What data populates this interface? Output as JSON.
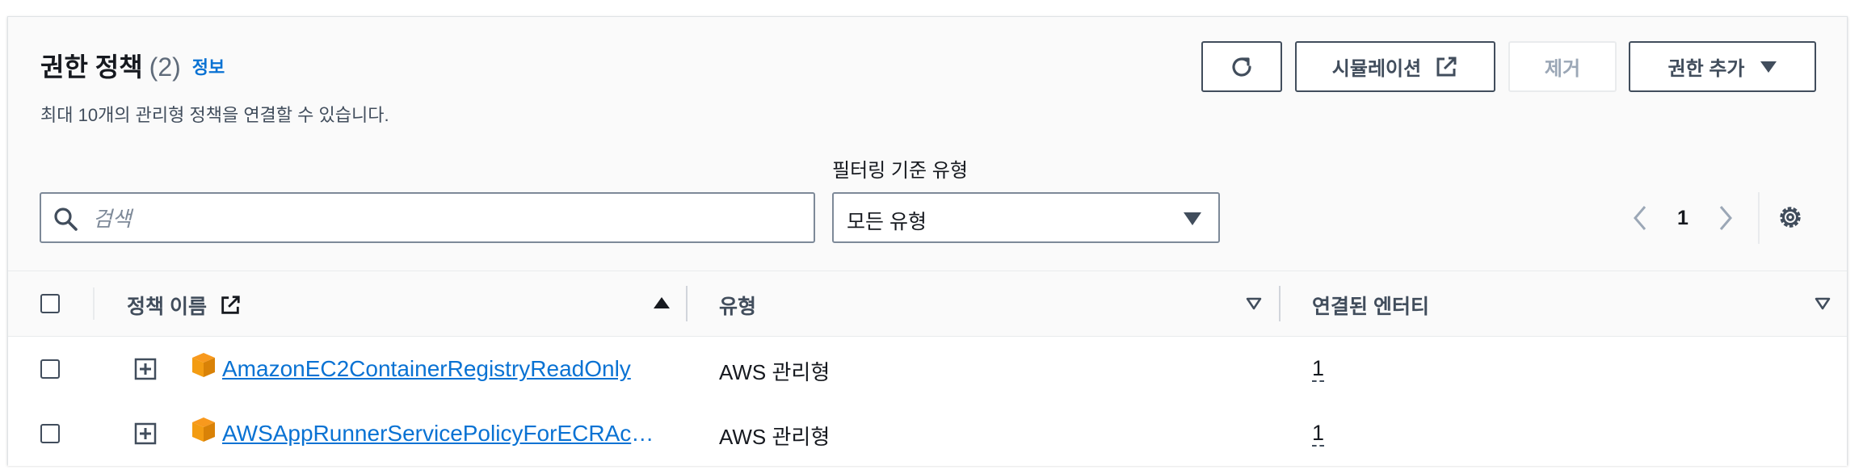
{
  "header": {
    "title": "권한 정책",
    "count": "(2)",
    "info_link": "정보",
    "subtitle": "최대 10개의 관리형 정책을 연결할 수 있습니다."
  },
  "actions": {
    "refresh_icon": "refresh-icon",
    "simulate_label": "시뮬레이션",
    "remove_label": "제거",
    "add_permission_label": "권한 추가"
  },
  "filters": {
    "search_placeholder": "검색",
    "search_value": "",
    "filter_label": "필터링 기준 유형",
    "filter_value": "모든 유형"
  },
  "pagination": {
    "current_page": "1"
  },
  "table": {
    "columns": [
      {
        "label": "정책 이름",
        "sort": "ascending"
      },
      {
        "label": "유형",
        "sort": "none"
      },
      {
        "label": "연결된 엔터티",
        "sort": "none"
      }
    ],
    "rows": [
      {
        "policy_name": "AmazonEC2ContainerRegistryReadOnly",
        "type": "AWS 관리형",
        "attached_entities": "1"
      },
      {
        "policy_name": "AWSAppRunnerServicePolicyForECRAccess",
        "type": "AWS 관리형",
        "attached_entities": "1"
      }
    ]
  },
  "colors": {
    "link": "#0972d3",
    "text": "#16191f",
    "border": "#7d8998",
    "aws_orange": "#f8991d"
  }
}
